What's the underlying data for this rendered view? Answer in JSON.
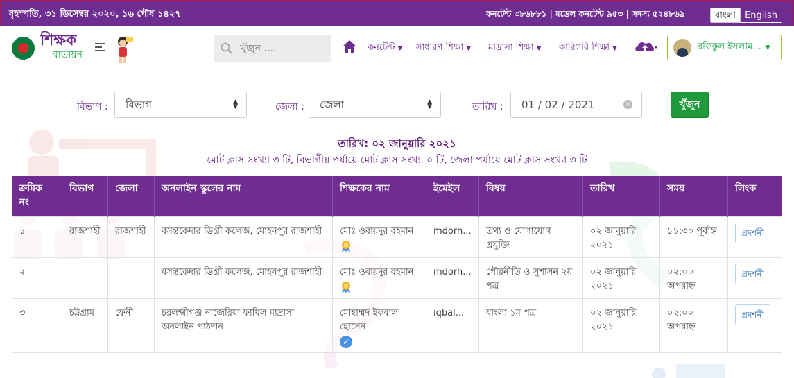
{
  "topbar": {
    "date": "বৃহস্পতি, ৩১ ডিসেম্বর ২০২০, ১৬ পৌষ ১৪২৭",
    "stats": "কনটেন্ট ৩৮৬৮৮১ | মডেল কনটেন্ট ৯৫৩ | সদস্য ৫২৪৮৬৯",
    "lang_bn": "বাংলা",
    "lang_en": "English"
  },
  "nav": {
    "brand_line1": "শিক্ষক",
    "brand_line2": "বাতায়ন",
    "search_placeholder": "খুঁজুন ....",
    "menu": [
      "কনটেন্ট",
      "সাধারণ শিক্ষা",
      "মাদ্রাসা শিক্ষা",
      "কারিগরি শিক্ষা"
    ],
    "user_name": "রফিকুল ইসলাম..."
  },
  "filters": {
    "division_label": "বিভাগ :",
    "division_value": "বিভাগ",
    "district_label": "জেলা :",
    "district_value": "জেলা",
    "date_label": "তারিখ :",
    "date_value": "01 / 02 / 2021",
    "search_button": "খুঁজুন"
  },
  "summary": {
    "date_line": "তারিখ: ০২ জানুয়ারি ২০২১",
    "counts_line": "মোট ক্লাস সংখ্যা ৩ টি, বিভাগীয় পর্যায়ে মোট ক্লাস সংখ্যা ০ টি, জেলা পর্যায়ে মোট ক্লাস সংখ্যা ৩ টি"
  },
  "table": {
    "headers": [
      "ক্রমিক নং",
      "বিভাগ",
      "জেলা",
      "অনলাইন স্কুলের নাম",
      "শিক্ষকের নাম",
      "ইমেইল",
      "বিষয়",
      "তারিখ",
      "সময়",
      "লিংক"
    ],
    "rows": [
      {
        "serial": "১",
        "division": "রাজশাহী",
        "district": "রাজশাহী",
        "school": "বসন্তকেদার ডিগ্রী কলেজ, মোহনপুর রাজশাহী",
        "teacher": "মোঃ ওবায়দুর রহমান",
        "badge": "award-icon",
        "email": "mdorh...",
        "subject": "তথ্য ও যোগাযোগ প্রযুক্তি",
        "date": "০২ জানুয়ারি ২০২১",
        "time": "১১:৩০ পূর্বাহ্ন",
        "link": "প্রদর্শনী"
      },
      {
        "serial": "২",
        "division": "",
        "district": "",
        "school": "বসন্তকেদার ডিগ্রী কলেজ, মোহনপুর রাজশাহী",
        "teacher": "মোঃ ওবায়দুর রহমান",
        "badge": "award-icon",
        "email": "mdorh...",
        "subject": "পৌরনীতি ও সুশাসন ২য় পত্র",
        "date": "০২ জানুয়ারি ২০২১",
        "time": "০২:০০ অপরাহ্ন",
        "link": "প্রদর্শনী"
      },
      {
        "serial": "৩",
        "division": "চট্টগ্রাম",
        "district": "ফেনী",
        "school": "চরলক্ষ্মীগঞ্জ নাজেরিয়া ফাযিল মাদ্রাসা অনলাইন পাঠদান",
        "teacher": "মোহাম্মদ ইকবাল হোসেন",
        "badge": "verified-check-icon",
        "email": "iqbal...",
        "subject": "বাংলা ১ম পত্র",
        "date": "০২ জানুয়ারি ২০২১",
        "time": "০২:০০ অপরাহ্ন",
        "link": "প্রদর্শনী"
      }
    ]
  },
  "colors": {
    "brand_purple": "#6f2c91",
    "accent_green": "#1aa34a",
    "button_green": "#1f9a3a"
  }
}
